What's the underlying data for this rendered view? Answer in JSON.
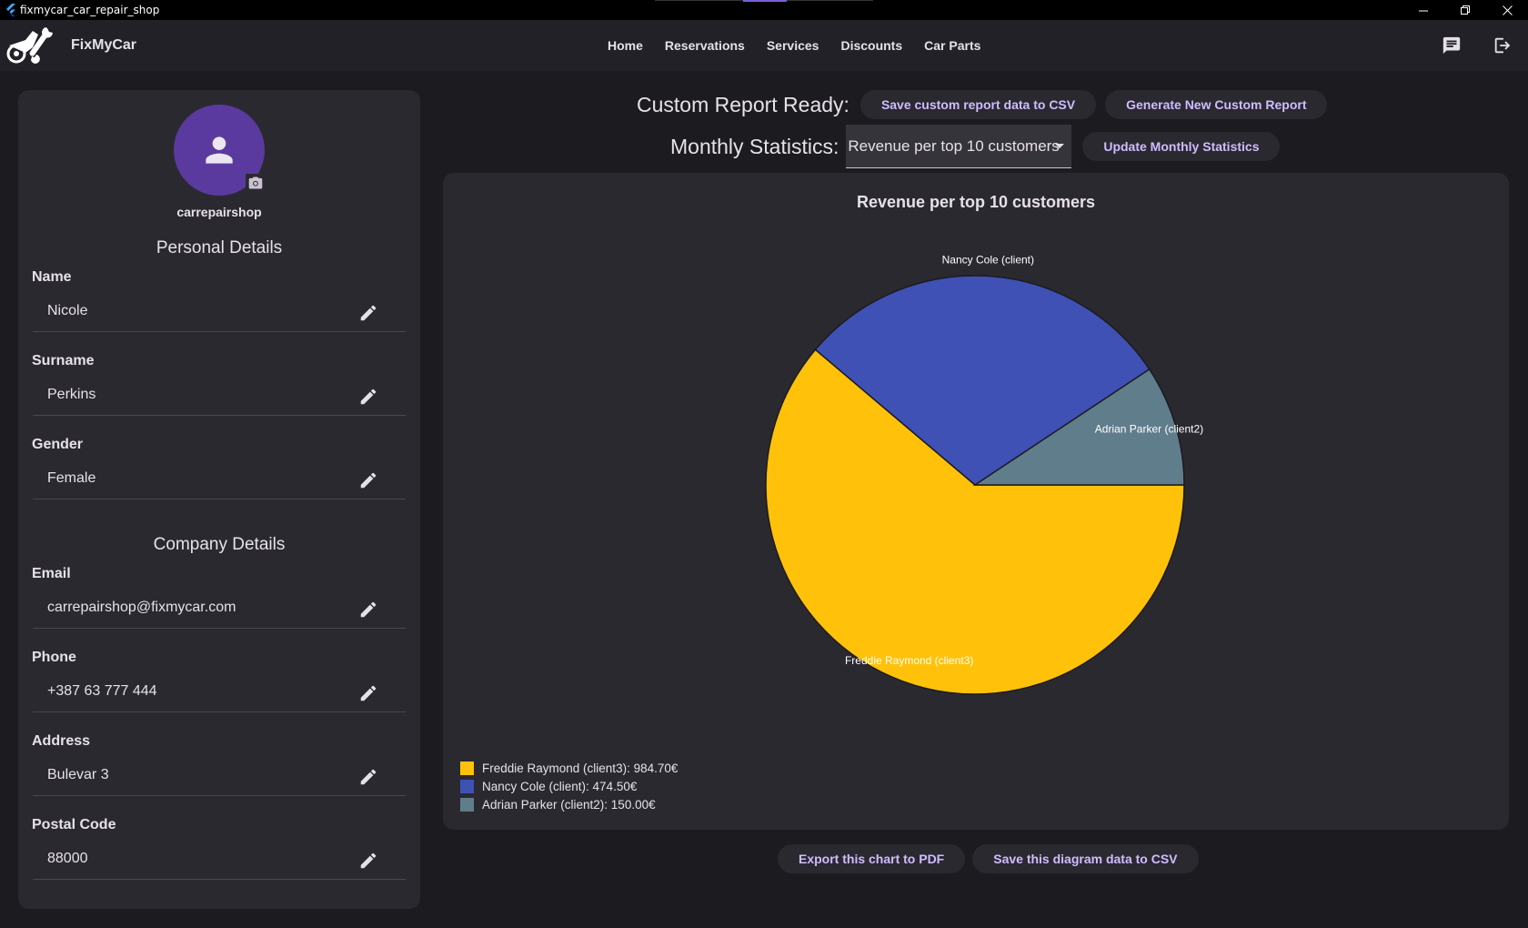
{
  "window": {
    "title": "fixmycar_car_repair_shop",
    "controls": [
      "minimize-icon",
      "restore-icon",
      "close-icon"
    ]
  },
  "appbar": {
    "app_name": "FixMyCar",
    "nav": [
      "Home",
      "Reservations",
      "Services",
      "Discounts",
      "Car Parts"
    ],
    "icons": [
      "chat-icon",
      "logout-icon"
    ]
  },
  "profile": {
    "username": "carrepairshop",
    "personal_title": "Personal Details",
    "company_title": "Company Details",
    "fields": [
      {
        "label": "Name",
        "value": "Nicole"
      },
      {
        "label": "Surname",
        "value": "Perkins"
      },
      {
        "label": "Gender",
        "value": "Female"
      },
      {
        "label": "Email",
        "value": "carrepairshop@fixmycar.com"
      },
      {
        "label": "Phone",
        "value": "+387 63 777 444"
      },
      {
        "label": "Address",
        "value": "Bulevar 3"
      },
      {
        "label": "Postal Code",
        "value": "88000"
      }
    ]
  },
  "report": {
    "ready_label": "Custom Report Ready:",
    "save_csv_label": "Save custom report data to CSV",
    "generate_label": "Generate New Custom Report"
  },
  "stats": {
    "label": "Monthly Statistics:",
    "selected": "Revenue per top 10 customers",
    "update_label": "Update Monthly Statistics"
  },
  "bottom": {
    "export_pdf_label": "Export this chart to PDF",
    "save_diagram_label": "Save this diagram data to CSV"
  },
  "colors": {
    "accent": "#cfbcff",
    "series": [
      "#ffc10a",
      "#3f51b5",
      "#607d8b"
    ]
  },
  "chart_data": {
    "type": "pie",
    "title": "Revenue per top 10 customers",
    "categories": [
      "Freddie Raymond (client3)",
      "Nancy Cole (client)",
      "Adrian Parker (client2)"
    ],
    "values": [
      984.7,
      474.5,
      150.0
    ],
    "unit": "€",
    "legend": [
      "Freddie Raymond (client3): 984.70€",
      "Nancy Cole (client): 474.50€",
      "Adrian Parker (client2): 150.00€"
    ],
    "legend_position": "bottom-left"
  }
}
